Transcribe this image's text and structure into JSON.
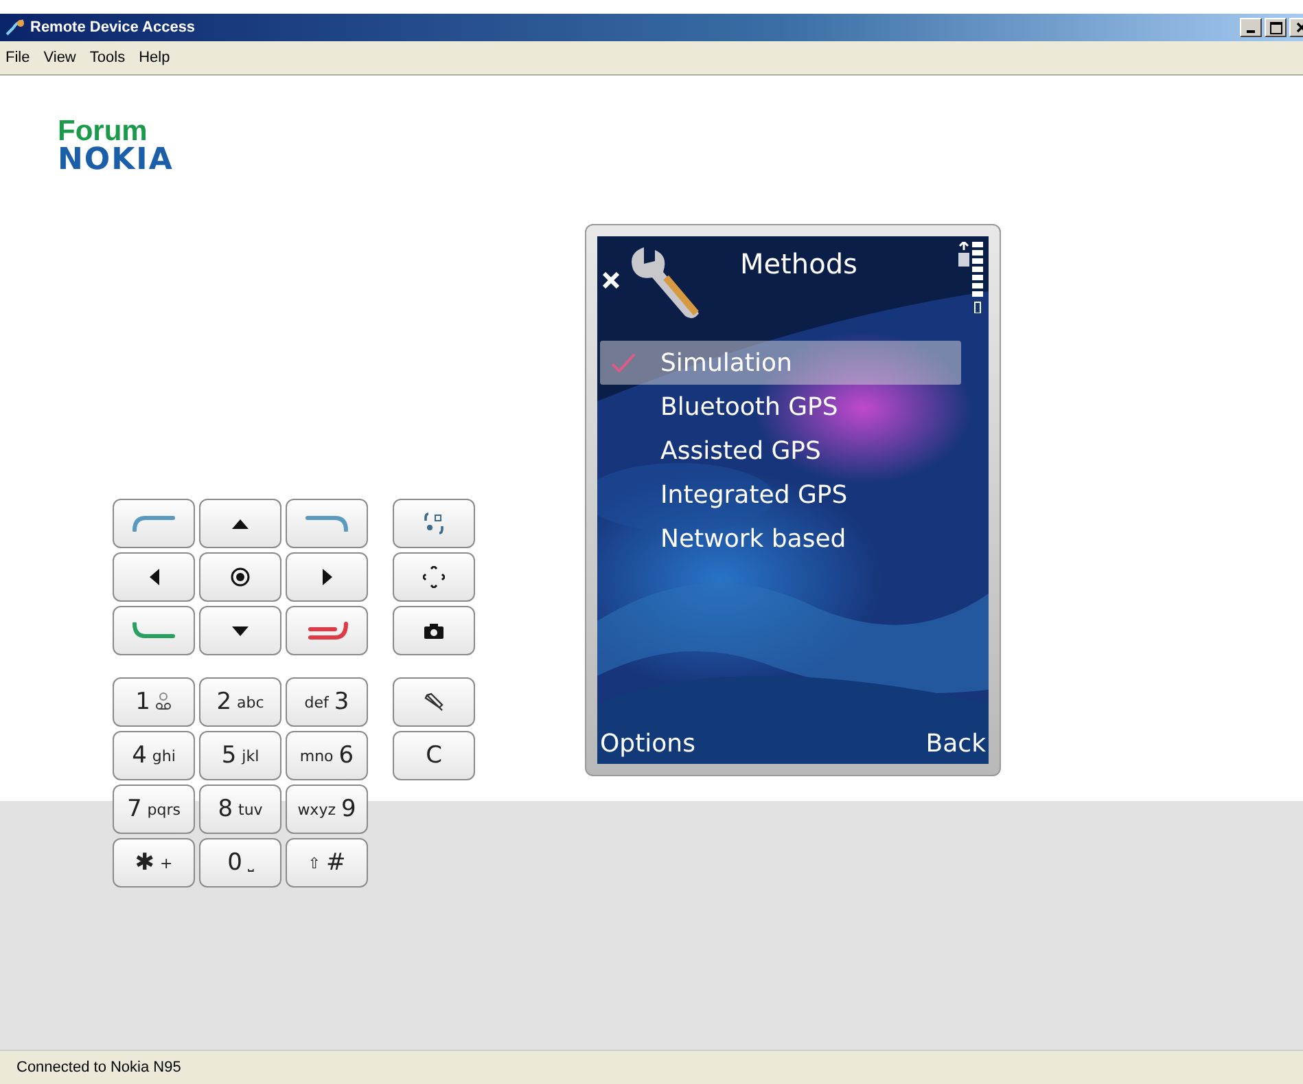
{
  "window": {
    "title": "Remote Device Access"
  },
  "menu": [
    {
      "label": "File"
    },
    {
      "label": "View"
    },
    {
      "label": "Tools"
    },
    {
      "label": "Help"
    }
  ],
  "logo": {
    "line_1": "Forum",
    "line_2": "NOKIA"
  },
  "keypad": {
    "keys": [
      {
        "kind": "voicemail",
        "digit": "1"
      },
      {
        "kind": "letters",
        "digit": "2",
        "letters": "abc"
      },
      {
        "kind": "letters_first",
        "digit": "3",
        "letters": "def"
      },
      {
        "kind": "letters",
        "digit": "4",
        "letters": "ghi"
      },
      {
        "kind": "letters",
        "digit": "5",
        "letters": "jkl"
      },
      {
        "kind": "letters_first",
        "digit": "6",
        "letters": "mno"
      },
      {
        "kind": "letters",
        "digit": "7",
        "letters": "pqrs"
      },
      {
        "kind": "letters",
        "digit": "8",
        "letters": "tuv"
      },
      {
        "kind": "letters_first",
        "digit": "9",
        "letters": "wxyz"
      },
      {
        "kind": "letters",
        "digit": "✱",
        "letters": "+"
      },
      {
        "kind": "letters",
        "digit": "0",
        "letters": "⎵"
      },
      {
        "kind": "letters_first",
        "digit": "#",
        "letters": "⇧"
      }
    ],
    "clear_key": "C"
  },
  "phone": {
    "title": "Methods",
    "items": [
      {
        "label": "Simulation",
        "selected": true,
        "checked": true
      },
      {
        "label": "Bluetooth GPS",
        "selected": false,
        "checked": false
      },
      {
        "label": "Assisted GPS",
        "selected": false,
        "checked": false
      },
      {
        "label": "Integrated GPS",
        "selected": false,
        "checked": false
      },
      {
        "label": "Network based",
        "selected": false,
        "checked": false
      }
    ],
    "left_softkey": "Options",
    "right_softkey": "Back"
  },
  "status_bar": "Connected to Nokia N95"
}
